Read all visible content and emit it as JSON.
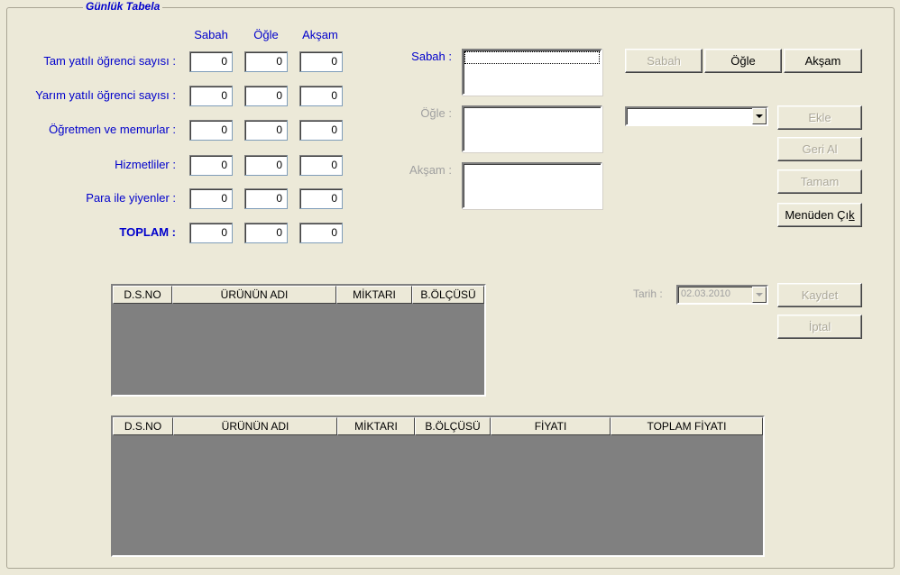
{
  "group_title": "Günlük Tabela",
  "columns": [
    "Sabah",
    "Öğle",
    "Akşam"
  ],
  "rows": [
    {
      "label": "Tam yatılı öğrenci sayısı :",
      "values": [
        "0",
        "0",
        "0"
      ]
    },
    {
      "label": "Yarım yatılı öğrenci sayısı :",
      "values": [
        "0",
        "0",
        "0"
      ]
    },
    {
      "label": "Öğretmen ve memurlar :",
      "values": [
        "0",
        "0",
        "0"
      ]
    },
    {
      "label": "Hizmetliler :",
      "values": [
        "0",
        "0",
        "0"
      ]
    },
    {
      "label": "Para ile yiyenler :",
      "values": [
        "0",
        "0",
        "0"
      ]
    },
    {
      "label": "TOPLAM :",
      "values": [
        "0",
        "0",
        "0"
      ]
    }
  ],
  "meals": {
    "sabah_label": "Sabah :",
    "ogle_label": "Öğle :",
    "aksam_label": "Akşam :"
  },
  "meal_buttons": {
    "sabah": "Sabah",
    "ogle": "Öğle",
    "aksam": "Akşam"
  },
  "actions": {
    "ekle": "Ekle",
    "geri_al": "Geri Al",
    "tamam": "Tamam",
    "menuden_cik_pre": "Menüden Çı",
    "menuden_cik_acc": "k",
    "kaydet": "Kaydet",
    "iptal": "İptal"
  },
  "product_combo": {
    "value": ""
  },
  "tarih": {
    "label": "Tarih :",
    "value": "02.03.2010"
  },
  "grid1": {
    "headers": [
      "D.S.NO",
      "ÜRÜNÜN ADI",
      "MİKTARI",
      "B.ÖLÇÜSÜ"
    ]
  },
  "grid2": {
    "headers": [
      "D.S.NO",
      "ÜRÜNÜN ADI",
      "MİKTARI",
      "B.ÖLÇÜSÜ",
      "FİYATI",
      "TOPLAM FİYATI"
    ]
  },
  "colors": {
    "background": "#ECE9D8",
    "label_blue": "#0000CC",
    "grid_body": "#808080",
    "disabled_text": "#ACA899"
  }
}
